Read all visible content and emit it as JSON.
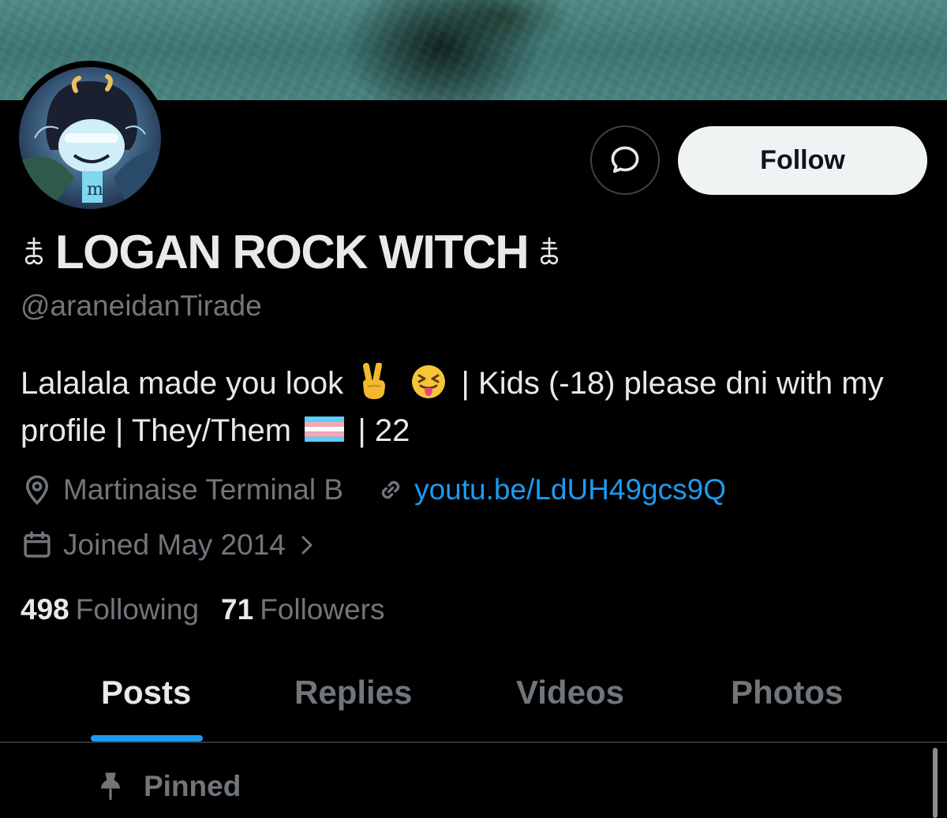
{
  "profile": {
    "display_name": "LOGAN ROCK WITCH",
    "handle": "@araneidanTirade",
    "bio_part1": "Lalalala made you look",
    "bio_part2": "| Kids (-18) please dni with my profile | They/Them",
    "bio_part3": "| 22",
    "location": "Martinaise Terminal B",
    "website": "youtu.be/LdUH49gcs9Q",
    "joined": "Joined May 2014",
    "following_count": "498",
    "following_label": "Following",
    "followers_count": "71",
    "followers_label": "Followers"
  },
  "actions": {
    "follow_label": "Follow"
  },
  "tabs": [
    {
      "label": "Posts",
      "active": true
    },
    {
      "label": "Replies",
      "active": false
    },
    {
      "label": "Videos",
      "active": false
    },
    {
      "label": "Photos",
      "active": false
    }
  ],
  "feed": {
    "pinned_label": "Pinned"
  },
  "icons": {
    "name_glyph": "leviathan-cross-icon",
    "message": "message-icon",
    "location": "location-pin-icon",
    "link": "link-icon",
    "calendar": "calendar-icon",
    "chevron": "chevron-right-icon",
    "pin": "pin-icon",
    "bio_emojis": [
      "victory-hand-emoji-icon",
      "squinting-tongue-emoji-icon",
      "transgender-flag-icon"
    ]
  },
  "colors": {
    "background": "#000000",
    "text_primary": "#e7e9ea",
    "text_secondary": "#71767b",
    "accent": "#1d9bf0",
    "follow_button": "#eff3f4"
  }
}
